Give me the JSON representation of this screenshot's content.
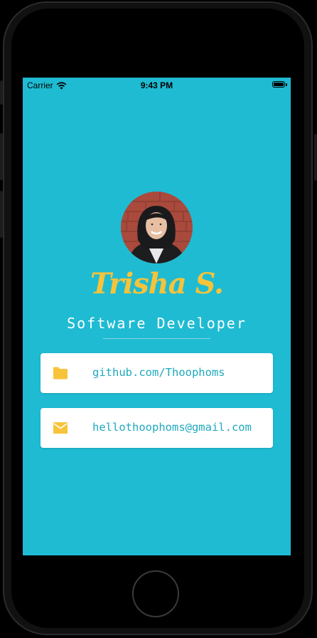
{
  "status_bar": {
    "carrier": "Carrier",
    "time": "9:43 PM"
  },
  "profile": {
    "name": "Trisha S.",
    "role": "Software Developer"
  },
  "contacts": [
    {
      "icon": "folder-icon",
      "text": "github.com/Thoophoms"
    },
    {
      "icon": "mail-icon",
      "text": "hellothoophoms@gmail.com"
    }
  ],
  "colors": {
    "background": "#1FBBD2",
    "accent": "#F7C33A",
    "card_text": "#1FA9BE"
  }
}
